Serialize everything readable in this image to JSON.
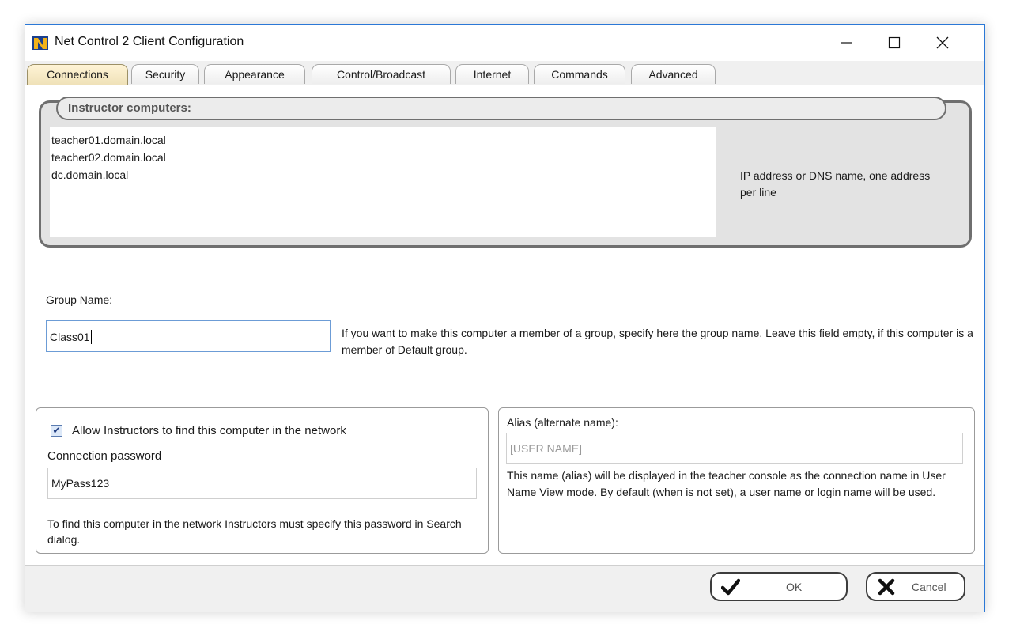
{
  "window": {
    "title": "Net Control 2 Client Configuration",
    "controls": {
      "minimize": "minimize",
      "maximize": "maximize",
      "close": "close"
    }
  },
  "tabs": [
    {
      "label": "Connections",
      "active": true
    },
    {
      "label": "Security",
      "active": false
    },
    {
      "label": "Appearance",
      "active": false
    },
    {
      "label": "Control/Broadcast",
      "active": false
    },
    {
      "label": "Internet",
      "active": false
    },
    {
      "label": "Commands",
      "active": false
    },
    {
      "label": "Advanced",
      "active": false
    }
  ],
  "instructors": {
    "header": "Instructor computers:",
    "lines": [
      "teacher01.domain.local",
      "teacher02.domain.local",
      "dc.domain.local"
    ],
    "hint": "IP address or DNS name, one address per line"
  },
  "group": {
    "label": "Group Name:",
    "value": "Class01",
    "hint": "If you want to make this computer a member of a group, specify here the group name. Leave this field empty, if this computer is a member of Default group."
  },
  "find": {
    "checkbox_label": "Allow Instructors to find this computer in the network",
    "checked": true,
    "password_label": "Connection password",
    "password_value": "MyPass123",
    "hint": "To find this computer in the network Instructors must specify this password in Search dialog."
  },
  "alias": {
    "label": "Alias (alternate name):",
    "placeholder": "[USER NAME]",
    "hint": "This name (alias) will be displayed in the teacher console as the connection name in User Name View mode. By default (when is not set), a user name or login name will be used."
  },
  "buttons": {
    "ok": "OK",
    "cancel": "Cancel"
  },
  "colors": {
    "window_border": "#2b78d6",
    "instr_box_bg": "#e3e3e3",
    "footer_bg": "#f0f0f0"
  }
}
